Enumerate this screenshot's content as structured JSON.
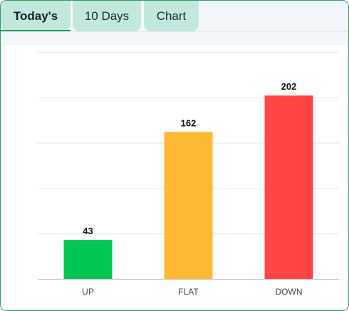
{
  "tabs": [
    {
      "label": "Today's",
      "active": true
    },
    {
      "label": "10 Days",
      "active": false
    },
    {
      "label": "Chart",
      "active": false
    }
  ],
  "colors": {
    "border": "#2e9e62",
    "tab_bg": "#c2e7dc",
    "up": "#00c853",
    "flat": "#ffb833",
    "down": "#ff4545"
  },
  "chart_data": {
    "type": "bar",
    "categories": [
      "UP",
      "FLAT",
      "DOWN"
    ],
    "values": [
      43,
      162,
      202
    ],
    "colors": [
      "#00c853",
      "#ffb833",
      "#ff4545"
    ],
    "data_labels": [
      "43",
      "162",
      "202"
    ],
    "title": "",
    "xlabel": "",
    "ylabel": "",
    "ylim": [
      0,
      250
    ],
    "grid": true,
    "legend": "none"
  }
}
